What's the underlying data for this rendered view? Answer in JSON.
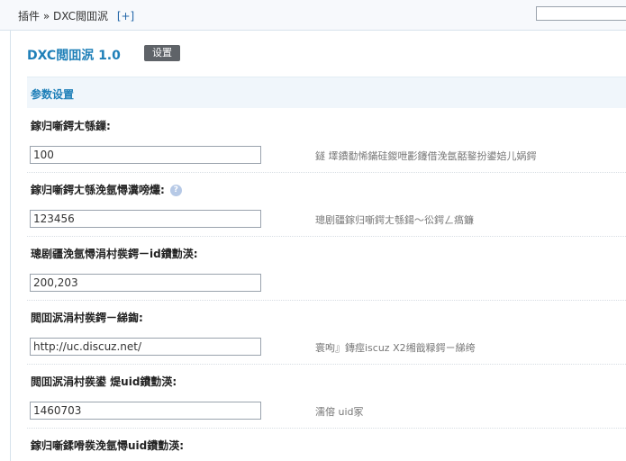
{
  "breadcrumb": {
    "root": "插件",
    "separator": "»",
    "current": "DXC閲囬泦",
    "expand": "[+]"
  },
  "header": {
    "title": "DXC閲囬泦  1.0",
    "settings_badge": "设置"
  },
  "section": {
    "title": "参数设置"
  },
  "fields": [
    {
      "label": "鎵归噺鍔ㄤ綔鏁:",
      "value": "100",
      "hint": "鐩   墿鐨勫悕鏋硅鍐呭彲鑳借浼氬嚭鐜扮鍙婄儿娲鍔"
    },
    {
      "label": "鎵归噺鍔ㄤ綔浼氬憳瀵嗙爜:",
      "value": "123456",
      "hint": "璁剧疆鎵归噺鍔ㄤ綔鍚〜彸鍔ㄥ瘑鐮"
    },
    {
      "label": "璁剧疆浼氬憳涓村彂鍔ㄧid鐨勯渶:",
      "value": "200,203",
      "hint": ""
    },
    {
      "label": "閲囬泦涓村彂鍔ㄧ綈鍧:",
      "value": "http://uc.discuz.net/",
      "hint": "寰呴』鏄痙iscuz X2缃戠粶鍔ㄧ綈绔",
      "hint_short": ""
    },
    {
      "label": "閲囬泦涓村彂鍙  煶uid鐨勯渶:",
      "value": "1460703",
      "hint": "濡傛   uid冢"
    },
    {
      "label": "鎵归噺鍒嗗彂浼氬憳uid鐨勯渶:",
      "value": "",
      "hint": ""
    }
  ]
}
